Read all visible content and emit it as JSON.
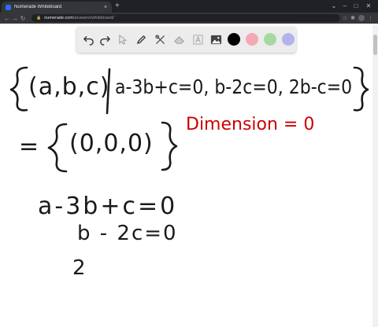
{
  "browser": {
    "tab_title": "Numerade Whiteboard",
    "tab_close": "×",
    "new_tab": "+",
    "url_host": "numerade.com",
    "url_path": "/answers/whiteboard/"
  },
  "whiteboard": {
    "tools": [
      "undo-icon",
      "redo-icon",
      "select-icon",
      "pen-icon",
      "shapes-icon",
      "eraser-icon",
      "text-icon",
      "image-icon"
    ],
    "colors": [
      "#000000",
      "#f4a8b4",
      "#a6d9a0",
      "#b3b3ec"
    ],
    "ink": {
      "black": "#1a1a1a",
      "red": "#cc0000"
    }
  },
  "board": {
    "set_line": "{ (a,b,c) | a-3b+c=0, b-2c=0, 2b-c=0 }",
    "equals_line": "= { (0,0,0) }",
    "dimension_label": "Dimension = 0",
    "eq1": "a-3b+c=0",
    "eq2": "b - 2c=0",
    "eq3": "2"
  }
}
